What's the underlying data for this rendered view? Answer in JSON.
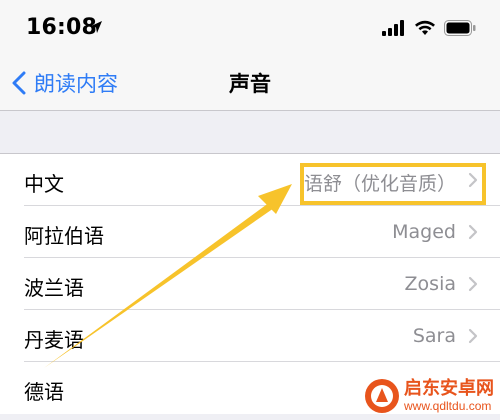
{
  "status_bar": {
    "time": "16:08",
    "icons": [
      "location-arrow-icon",
      "cellular-signal-icon",
      "wifi-icon",
      "battery-icon"
    ]
  },
  "nav": {
    "back_label": "朗读内容",
    "title": "声音"
  },
  "rows": [
    {
      "label": "中文",
      "value": "语舒（优化音质）"
    },
    {
      "label": "阿拉伯语",
      "value": "Maged"
    },
    {
      "label": "波兰语",
      "value": "Zosia"
    },
    {
      "label": "丹麦语",
      "value": "Sara"
    },
    {
      "label": "德语",
      "value": ""
    }
  ],
  "annotation": {
    "highlight_color": "#f7c32b"
  },
  "watermark": {
    "title": "启东安卓网",
    "url": "www.qdltdu.com"
  },
  "colors": {
    "accent": "#2f7cf6",
    "secondary_text": "#8e8e93"
  }
}
